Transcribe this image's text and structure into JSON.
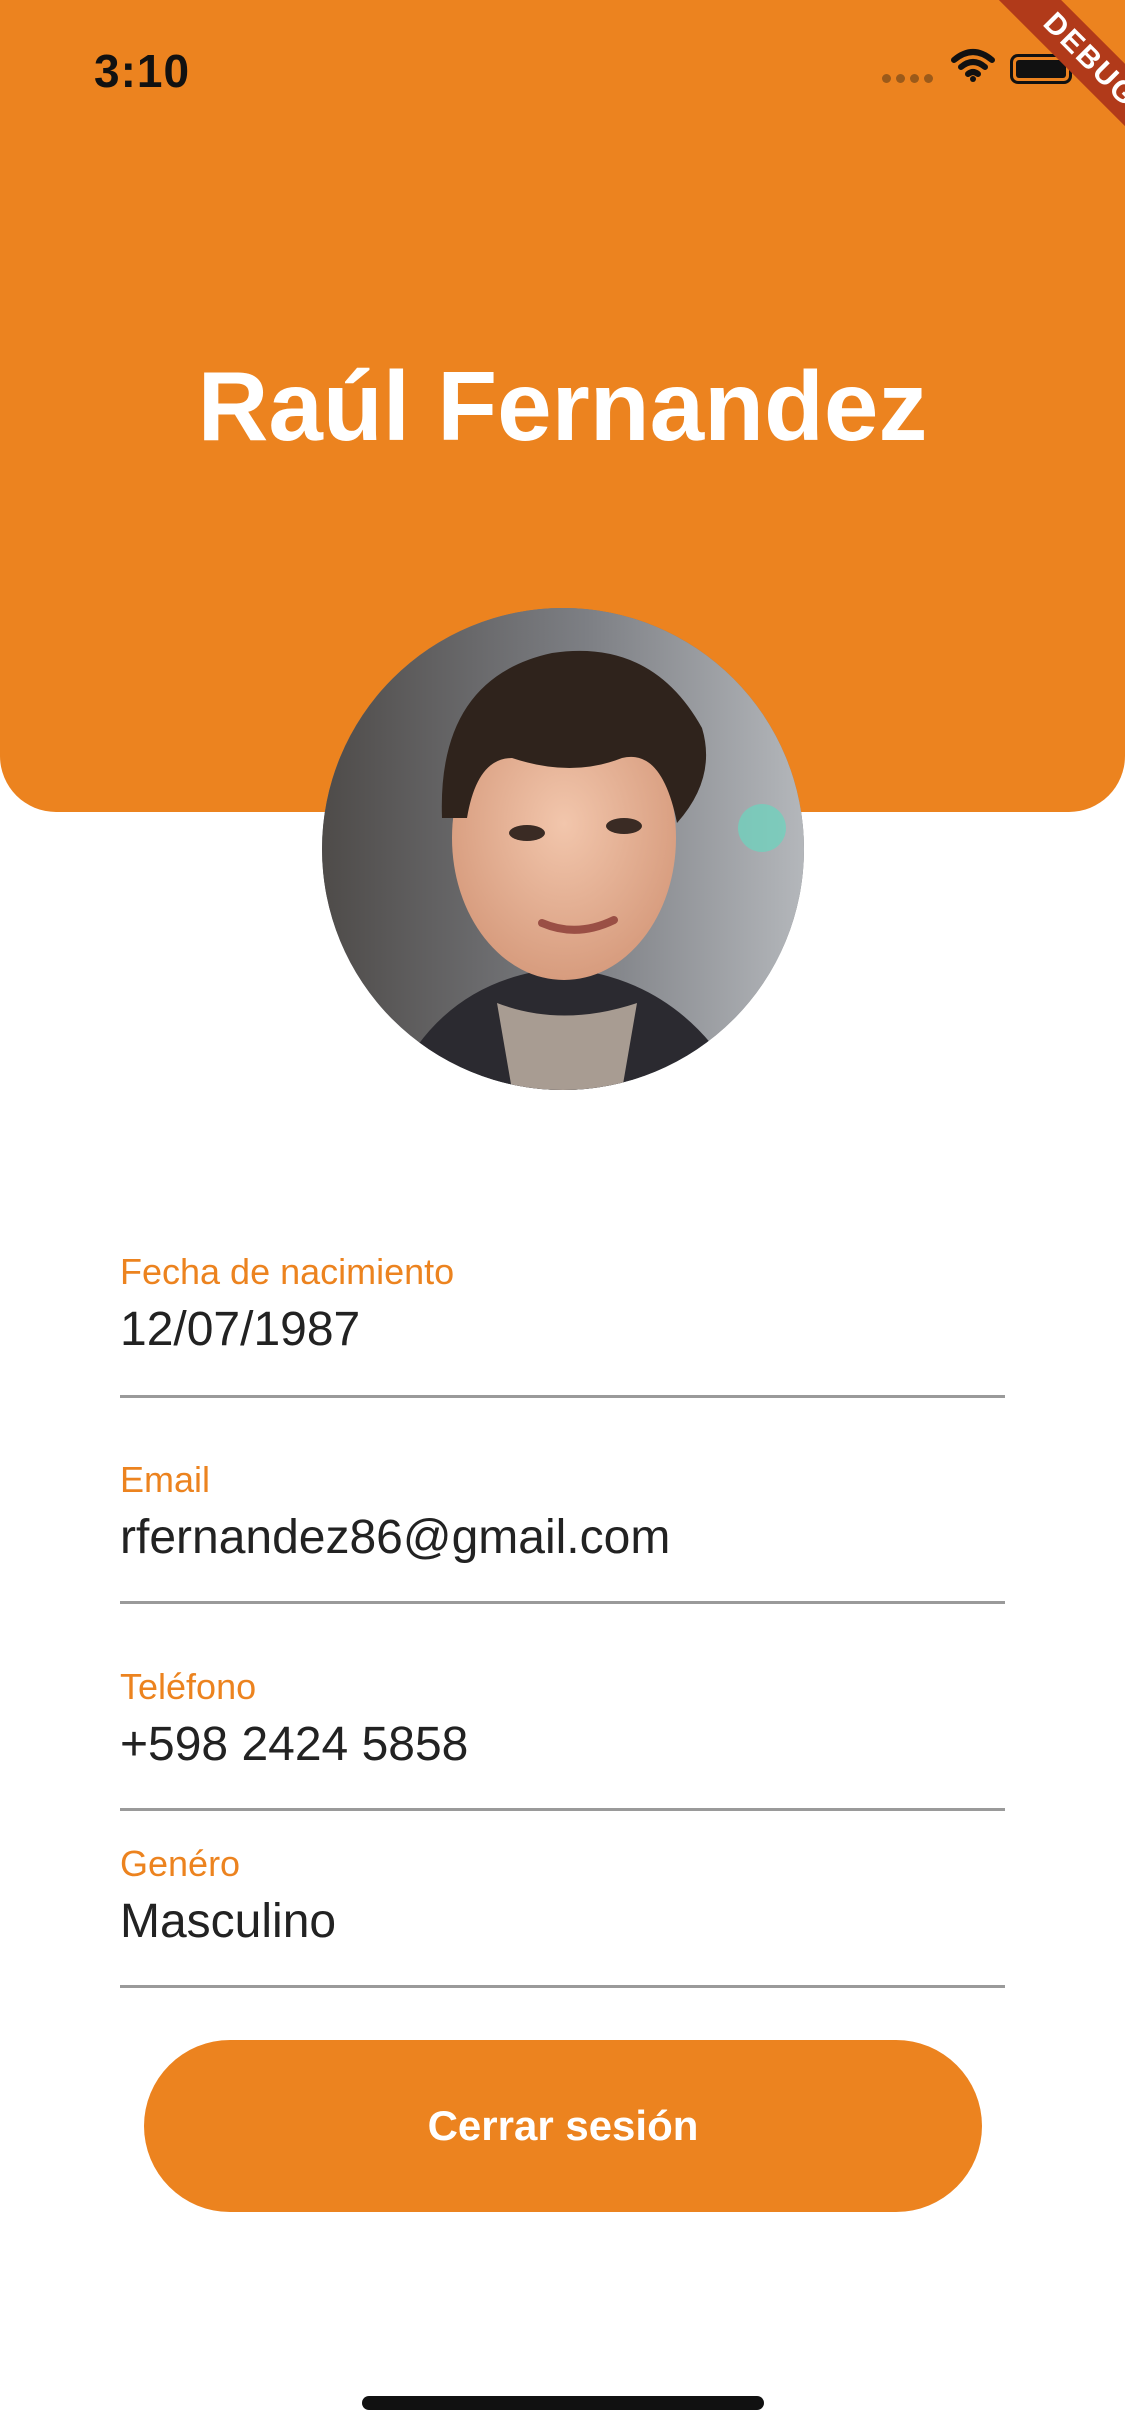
{
  "status_bar": {
    "time": "3:10"
  },
  "debug_banner": {
    "label": "DEBUG"
  },
  "profile": {
    "name": "Raúl Fernandez"
  },
  "fields": {
    "birth_date": {
      "label": "Fecha de nacimiento",
      "value": "12/07/1987"
    },
    "email": {
      "label": "Email",
      "value": "rfernandez86@gmail.com"
    },
    "phone": {
      "label": "Teléfono",
      "value": "+598 2424 5858"
    },
    "gender": {
      "label": "Genéro",
      "value": "Masculino"
    }
  },
  "actions": {
    "logout_label": "Cerrar sesión"
  },
  "colors": {
    "accent": "#EC831F",
    "text": "#222222",
    "divider": "#9A9A9A",
    "debug_banner": "#B13A1A"
  }
}
